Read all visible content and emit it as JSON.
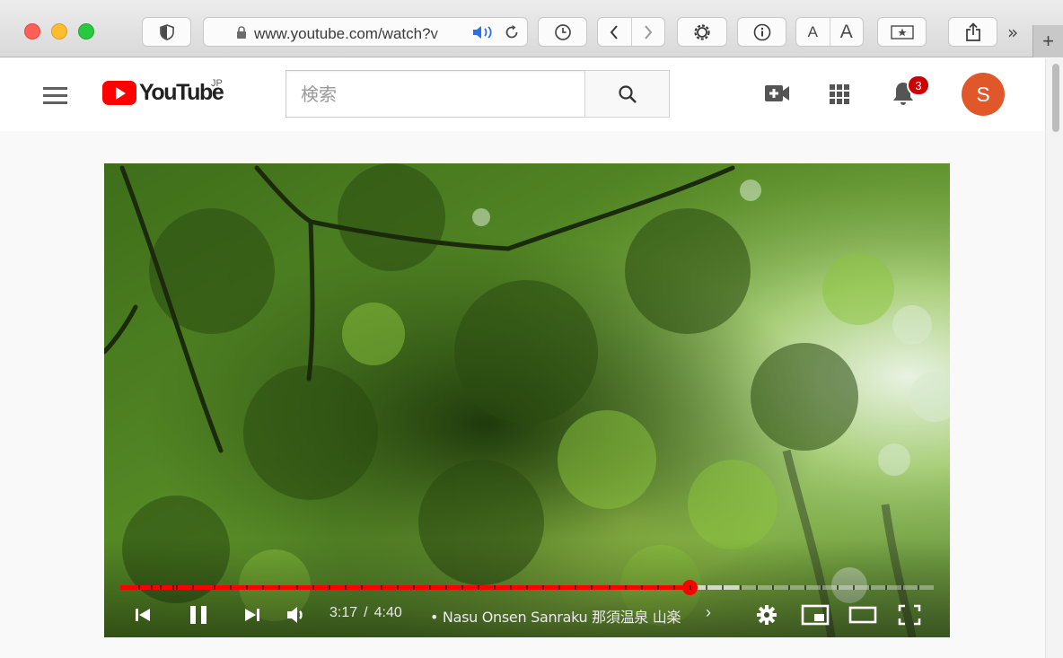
{
  "browser": {
    "url_text": "www.youtube.com/watch?v",
    "reader_font_small": "A",
    "reader_font_large": "A",
    "more_label": "»",
    "new_tab_label": "+"
  },
  "youtube": {
    "logo_text": "YouTube",
    "region": "JP",
    "search_placeholder": "検索",
    "notification_count": "3",
    "avatar_letter": "S"
  },
  "player": {
    "current_time": "3:17",
    "separator": "/",
    "duration": "4:40",
    "title": "• Nasu Onsen Sanraku 那須温泉 山楽",
    "title_chevron": "›",
    "played_fraction": 0.7,
    "loaded_fraction": 0.76,
    "accent_color": "#ff0000"
  }
}
